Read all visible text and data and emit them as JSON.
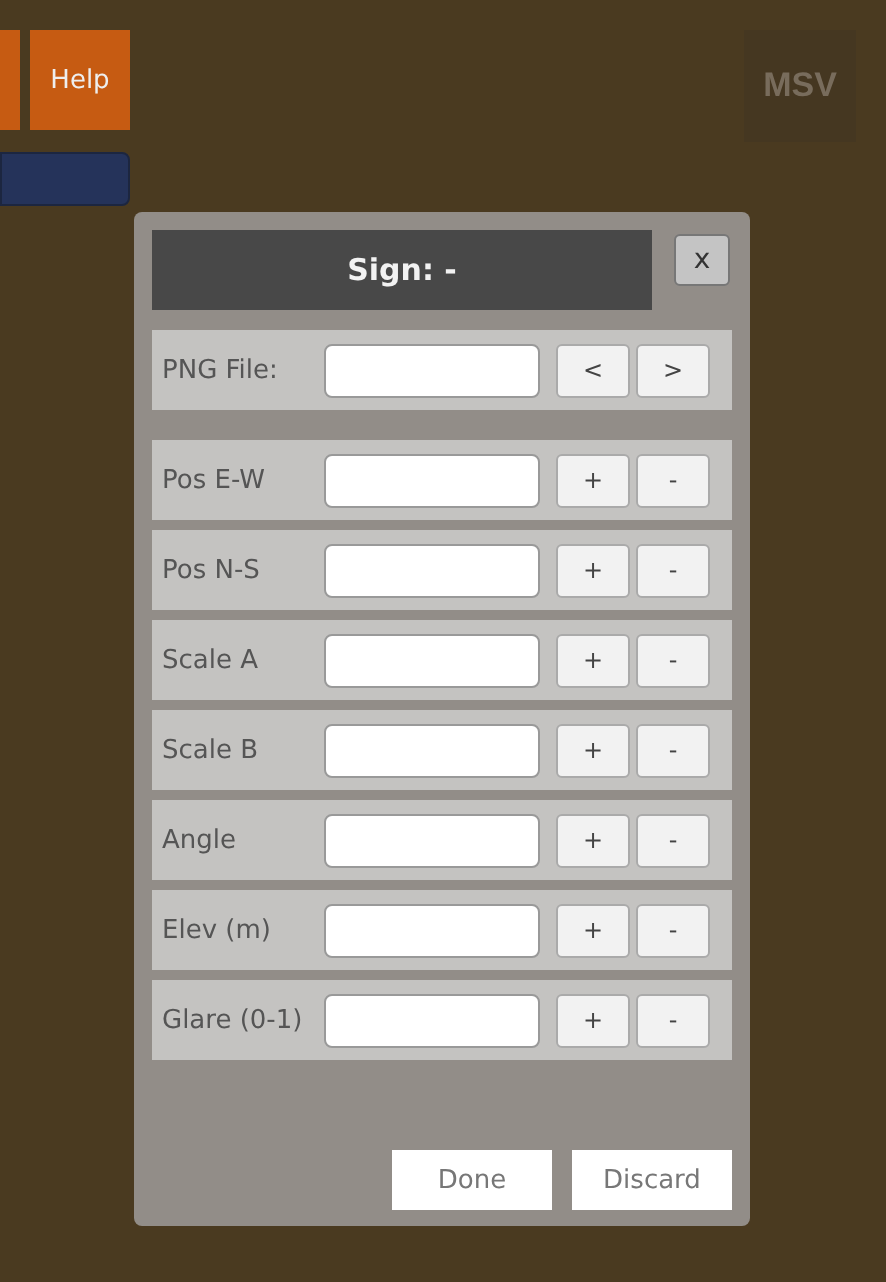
{
  "top_buttons": [
    {
      "label": "Help"
    }
  ],
  "logo": {
    "text": "MSV"
  },
  "dialog": {
    "title": "Sign: -",
    "close": "x",
    "rows": [
      {
        "label": "PNG File:",
        "buttons": [
          "<",
          ">"
        ]
      },
      {
        "label": "Pos E-W",
        "buttons": [
          "+",
          "-"
        ]
      },
      {
        "label": "Pos N-S",
        "buttons": [
          "+",
          "-"
        ]
      },
      {
        "label": "Scale A",
        "buttons": [
          "+",
          "-"
        ]
      },
      {
        "label": "Scale B",
        "buttons": [
          "+",
          "-"
        ]
      },
      {
        "label": "Angle",
        "buttons": [
          "+",
          "-"
        ]
      },
      {
        "label": "Elev (m)",
        "buttons": [
          "+",
          "-"
        ]
      },
      {
        "label": "Glare (0-1)",
        "buttons": [
          "+",
          "-"
        ]
      }
    ],
    "actions": [
      "Done",
      "Discard"
    ]
  }
}
